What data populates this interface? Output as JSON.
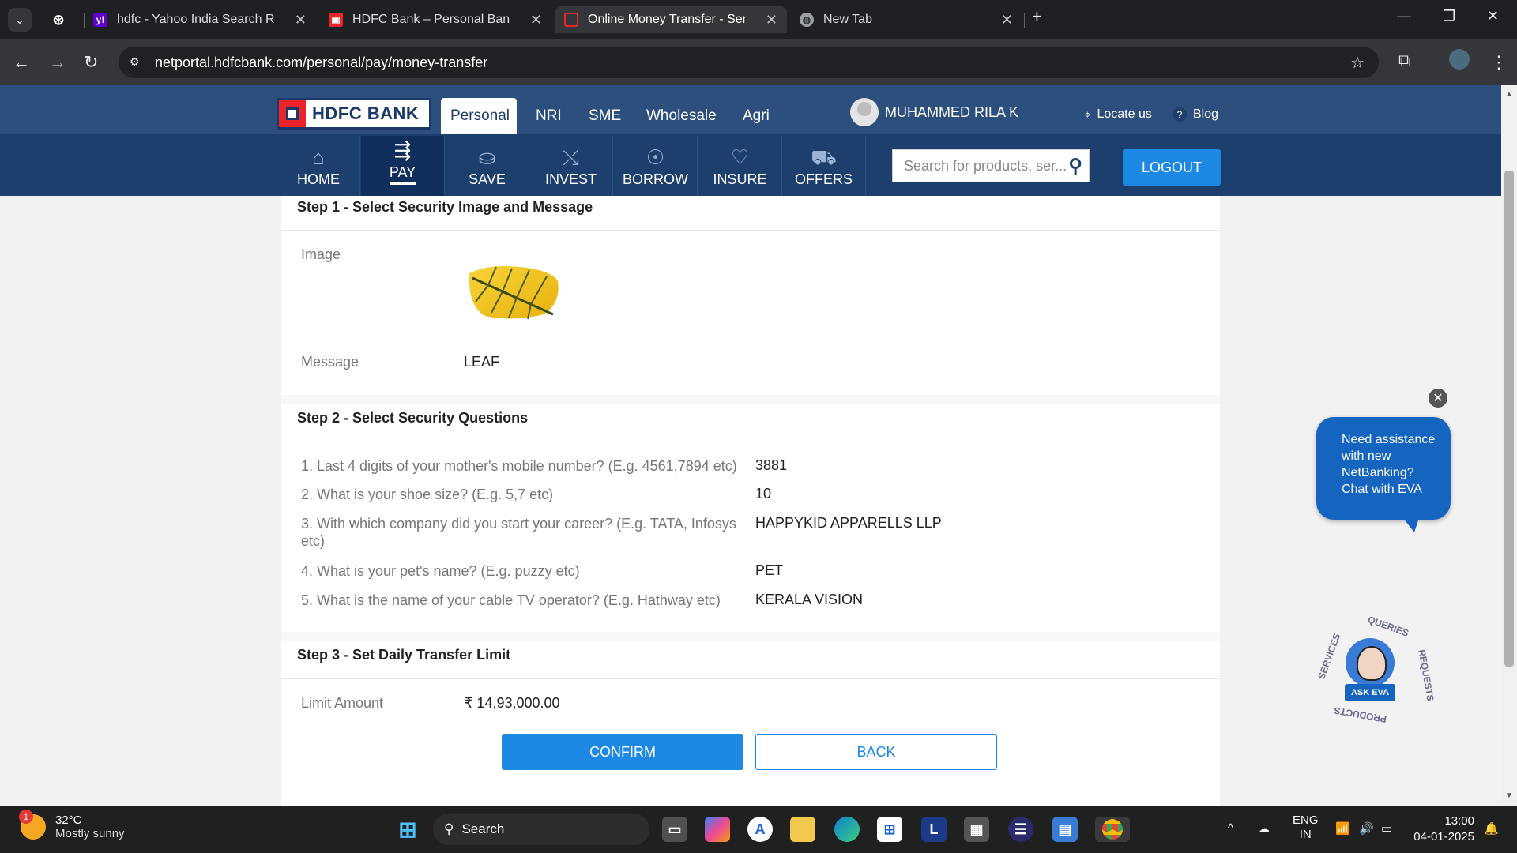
{
  "browser": {
    "tabs": [
      {
        "title": "",
        "icon": "chatgpt-icon"
      },
      {
        "title": "hdfc - Yahoo India Search Resul",
        "icon": "yahoo-icon"
      },
      {
        "title": "HDFC Bank – Personal Banking",
        "icon": "hdfc-icon"
      },
      {
        "title": "Online Money Transfer - Send &",
        "icon": "hdfc-icon",
        "active": true
      },
      {
        "title": "New Tab",
        "icon": "globe-icon"
      }
    ],
    "url": "netportal.hdfcbank.com/personal/pay/money-transfer"
  },
  "header": {
    "logo_text": "HDFC BANK",
    "segments": [
      "Personal",
      "NRI",
      "SME",
      "Wholesale",
      "Agri"
    ],
    "active_segment": "Personal",
    "user_name": "MUHAMMED RILA K",
    "locate_label": "Locate us",
    "blog_label": "Blog"
  },
  "menu": {
    "items": [
      {
        "label": "HOME",
        "icon": "home-icon"
      },
      {
        "label": "PAY",
        "icon": "pay-icon",
        "active": true
      },
      {
        "label": "SAVE",
        "icon": "save-icon"
      },
      {
        "label": "INVEST",
        "icon": "invest-icon"
      },
      {
        "label": "BORROW",
        "icon": "borrow-icon"
      },
      {
        "label": "INSURE",
        "icon": "insure-icon"
      },
      {
        "label": "OFFERS",
        "icon": "offers-icon"
      }
    ],
    "search_placeholder": "Search for products, ser...",
    "logout_label": "LOGOUT"
  },
  "step1": {
    "title": "Step 1 - Select Security Image and Message",
    "image_label": "Image",
    "message_label": "Message",
    "message_value": "LEAF"
  },
  "step2": {
    "title": "Step 2 - Select Security Questions",
    "questions": [
      {
        "q": "1. Last 4 digits of your mother's mobile number? (E.g. 4561,7894 etc)",
        "a": "3881"
      },
      {
        "q": "2. What is your shoe size? (E.g. 5,7 etc)",
        "a": "10"
      },
      {
        "q": "3. With which company did you start your career? (E.g. TATA, Infosys etc)",
        "a": "HAPPYKID APPARELLS LLP"
      },
      {
        "q": "4. What is your pet's name? (E.g. puzzy etc)",
        "a": "PET"
      },
      {
        "q": "5. What is the name of your cable TV operator? (E.g. Hathway etc)",
        "a": "KERALA VISION"
      }
    ]
  },
  "step3": {
    "title": "Step 3 - Set Daily Transfer Limit",
    "limit_label": "Limit Amount",
    "limit_value": "₹ 14,93,000.00"
  },
  "buttons": {
    "confirm": "CONFIRM",
    "back": "BACK"
  },
  "eva": {
    "bubble_text": "Need assistance with new NetBanking? Chat with EVA",
    "tag": "ASK EVA",
    "ring_labels": [
      "QUERIES",
      "REQUESTS",
      "PRODUCTS",
      "SERVICES"
    ]
  },
  "taskbar": {
    "weather_temp": "32°C",
    "weather_desc": "Mostly sunny",
    "weather_badge": "1",
    "search_label": "Search",
    "lang_1": "ENG",
    "lang_2": "IN",
    "time": "13:00",
    "date": "04-01-2025"
  }
}
